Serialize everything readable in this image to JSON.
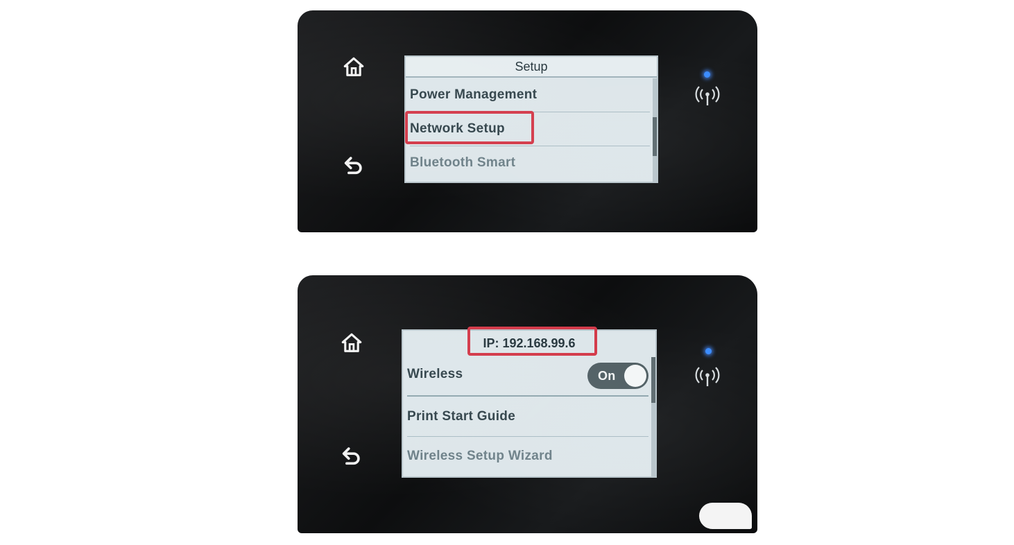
{
  "screenshot_1": {
    "screen_title": "Setup",
    "menu_items": [
      "Power Management",
      "Network Setup",
      "Bluetooth Smart"
    ]
  },
  "screenshot_2": {
    "ip_text": "IP: 192.168.99.6",
    "menu_items": [
      "Wireless",
      "Print Start Guide",
      "Wireless Setup Wizard"
    ],
    "wireless_toggle": {
      "label": "On",
      "state": "on"
    }
  },
  "icons": {
    "home": "home-icon",
    "back": "back-arrow-icon",
    "wireless": "wireless-signal-icon"
  },
  "colors": {
    "highlight": "#d33848",
    "status_led": "#3a8cff",
    "screen_bg": "#dde6ea"
  }
}
